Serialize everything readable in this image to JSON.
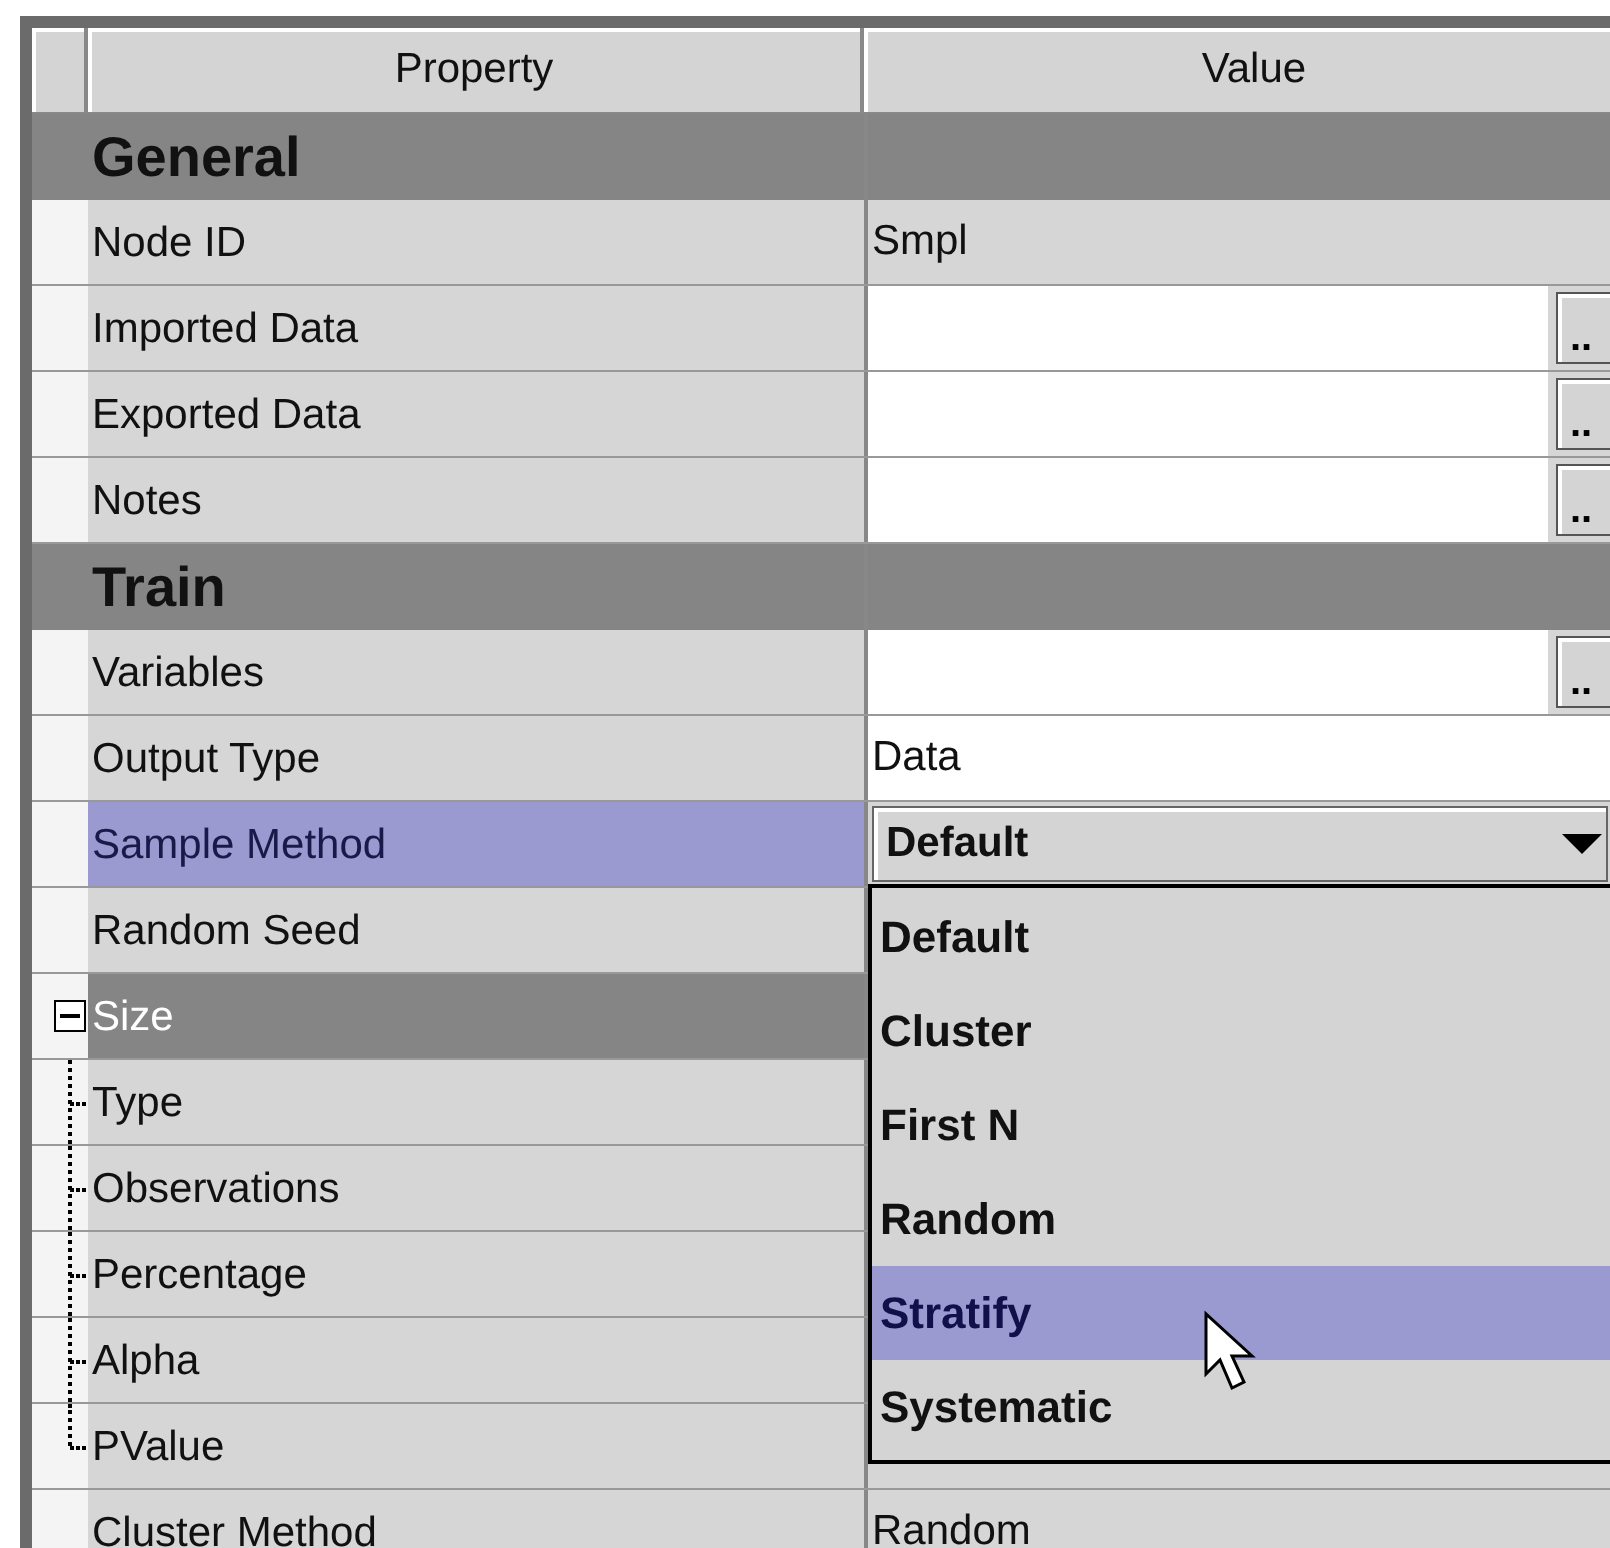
{
  "columns": [
    "Property",
    "Value"
  ],
  "rows": [
    {
      "kind": "section",
      "label": "General"
    },
    {
      "kind": "text",
      "label": "Node ID",
      "value": "Smpl",
      "editable": false,
      "selected": false
    },
    {
      "kind": "dialog",
      "label": "Imported Data",
      "button": "..",
      "selected": false
    },
    {
      "kind": "dialog",
      "label": "Exported Data",
      "button": "..",
      "selected": false
    },
    {
      "kind": "dialog",
      "label": "Notes",
      "button": "..",
      "selected": false
    },
    {
      "kind": "section",
      "label": "Train"
    },
    {
      "kind": "dialog",
      "label": "Variables",
      "button": "..",
      "selected": false
    },
    {
      "kind": "text",
      "label": "Output Type",
      "value": "Data",
      "editable": true,
      "selected": false
    },
    {
      "kind": "combo",
      "label": "Sample Method",
      "value": "Default",
      "selected": true
    },
    {
      "kind": "text",
      "label": "Random Seed",
      "selected": false
    },
    {
      "kind": "group",
      "label": "Size",
      "expanded": true,
      "children": [
        {
          "label": "Type",
          "selected": false
        },
        {
          "label": "Observations",
          "selected": false
        },
        {
          "label": "Percentage",
          "selected": false
        },
        {
          "label": "Alpha",
          "selected": false
        },
        {
          "label": "PValue",
          "selected": false
        }
      ]
    },
    {
      "kind": "text",
      "label": "Cluster Method",
      "value": "Random",
      "editable": false,
      "selected": false
    }
  ],
  "dropdown": {
    "items": [
      {
        "label": "Default",
        "selected": false
      },
      {
        "label": "Cluster",
        "selected": false
      },
      {
        "label": "First N",
        "selected": false
      },
      {
        "label": "Random",
        "selected": false
      },
      {
        "label": "Stratify",
        "selected": true
      },
      {
        "label": "Systematic",
        "selected": false
      }
    ]
  }
}
